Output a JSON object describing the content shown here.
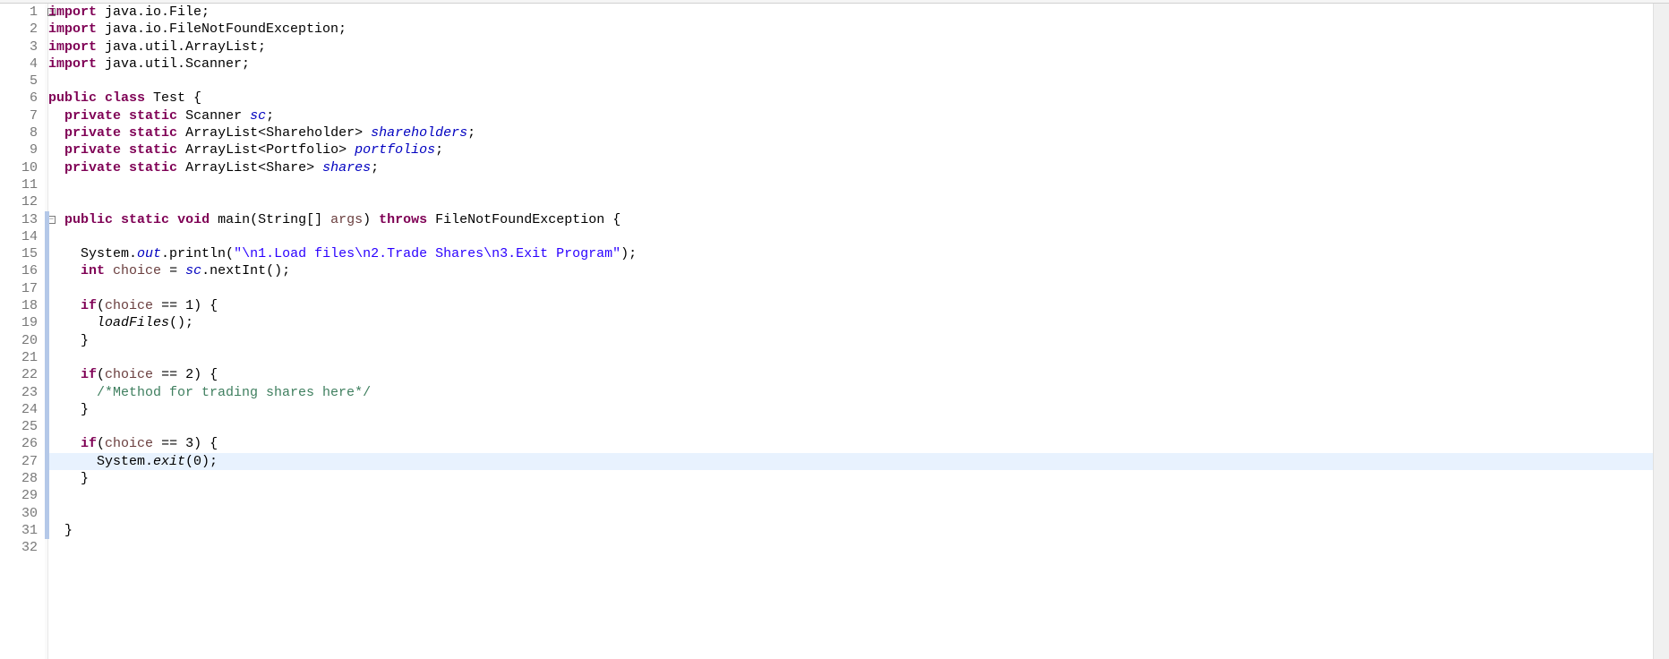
{
  "highlight_line": 27,
  "change_bar_start": 13,
  "change_bar_end": 31,
  "fold_markers": [
    1,
    13
  ],
  "lines": [
    {
      "n": 1,
      "tokens": [
        {
          "t": "import",
          "c": "kw"
        },
        {
          "t": " java.io.File;",
          "c": ""
        }
      ]
    },
    {
      "n": 2,
      "tokens": [
        {
          "t": "import",
          "c": "kw"
        },
        {
          "t": " java.io.FileNotFoundException;",
          "c": ""
        }
      ]
    },
    {
      "n": 3,
      "tokens": [
        {
          "t": "import",
          "c": "kw"
        },
        {
          "t": " java.util.ArrayList;",
          "c": ""
        }
      ]
    },
    {
      "n": 4,
      "tokens": [
        {
          "t": "import",
          "c": "kw"
        },
        {
          "t": " java.util.Scanner;",
          "c": ""
        }
      ]
    },
    {
      "n": 5,
      "tokens": []
    },
    {
      "n": 6,
      "tokens": [
        {
          "t": "public",
          "c": "kw"
        },
        {
          "t": " ",
          "c": ""
        },
        {
          "t": "class",
          "c": "kw"
        },
        {
          "t": " Test {",
          "c": ""
        }
      ]
    },
    {
      "n": 7,
      "tokens": [
        {
          "t": "  ",
          "c": ""
        },
        {
          "t": "private",
          "c": "kw"
        },
        {
          "t": " ",
          "c": ""
        },
        {
          "t": "static",
          "c": "kw"
        },
        {
          "t": " Scanner ",
          "c": ""
        },
        {
          "t": "sc",
          "c": "sfld"
        },
        {
          "t": ";",
          "c": ""
        }
      ]
    },
    {
      "n": 8,
      "tokens": [
        {
          "t": "  ",
          "c": ""
        },
        {
          "t": "private",
          "c": "kw"
        },
        {
          "t": " ",
          "c": ""
        },
        {
          "t": "static",
          "c": "kw"
        },
        {
          "t": " ArrayList<Shareholder> ",
          "c": ""
        },
        {
          "t": "shareholders",
          "c": "sfld"
        },
        {
          "t": ";",
          "c": ""
        }
      ]
    },
    {
      "n": 9,
      "tokens": [
        {
          "t": "  ",
          "c": ""
        },
        {
          "t": "private",
          "c": "kw"
        },
        {
          "t": " ",
          "c": ""
        },
        {
          "t": "static",
          "c": "kw"
        },
        {
          "t": " ArrayList<Portfolio> ",
          "c": ""
        },
        {
          "t": "portfolios",
          "c": "sfld"
        },
        {
          "t": ";",
          "c": ""
        }
      ]
    },
    {
      "n": 10,
      "tokens": [
        {
          "t": "  ",
          "c": ""
        },
        {
          "t": "private",
          "c": "kw"
        },
        {
          "t": " ",
          "c": ""
        },
        {
          "t": "static",
          "c": "kw"
        },
        {
          "t": " ArrayList<Share> ",
          "c": ""
        },
        {
          "t": "shares",
          "c": "sfld"
        },
        {
          "t": ";",
          "c": ""
        }
      ]
    },
    {
      "n": 11,
      "tokens": []
    },
    {
      "n": 12,
      "tokens": []
    },
    {
      "n": 13,
      "tokens": [
        {
          "t": "  ",
          "c": ""
        },
        {
          "t": "public",
          "c": "kw"
        },
        {
          "t": " ",
          "c": ""
        },
        {
          "t": "static",
          "c": "kw"
        },
        {
          "t": " ",
          "c": ""
        },
        {
          "t": "void",
          "c": "kw"
        },
        {
          "t": " main(String[] ",
          "c": ""
        },
        {
          "t": "args",
          "c": "arg"
        },
        {
          "t": ") ",
          "c": ""
        },
        {
          "t": "throws",
          "c": "kw"
        },
        {
          "t": " FileNotFoundException {",
          "c": ""
        }
      ]
    },
    {
      "n": 14,
      "tokens": []
    },
    {
      "n": 15,
      "tokens": [
        {
          "t": "    System.",
          "c": ""
        },
        {
          "t": "out",
          "c": "sfld"
        },
        {
          "t": ".println(",
          "c": ""
        },
        {
          "t": "\"\\n1.Load files\\n2.Trade Shares\\n3.Exit Program\"",
          "c": "str"
        },
        {
          "t": ");",
          "c": ""
        }
      ]
    },
    {
      "n": 16,
      "tokens": [
        {
          "t": "    ",
          "c": ""
        },
        {
          "t": "int",
          "c": "kw"
        },
        {
          "t": " ",
          "c": ""
        },
        {
          "t": "choice",
          "c": "loc"
        },
        {
          "t": " = ",
          "c": ""
        },
        {
          "t": "sc",
          "c": "sfld"
        },
        {
          "t": ".nextInt();",
          "c": ""
        }
      ]
    },
    {
      "n": 17,
      "tokens": []
    },
    {
      "n": 18,
      "tokens": [
        {
          "t": "    ",
          "c": ""
        },
        {
          "t": "if",
          "c": "kw"
        },
        {
          "t": "(",
          "c": ""
        },
        {
          "t": "choice",
          "c": "loc"
        },
        {
          "t": " == 1) {",
          "c": ""
        }
      ]
    },
    {
      "n": 19,
      "tokens": [
        {
          "t": "      ",
          "c": ""
        },
        {
          "t": "loadFiles",
          "c": "smeth"
        },
        {
          "t": "();",
          "c": ""
        }
      ]
    },
    {
      "n": 20,
      "tokens": [
        {
          "t": "    }",
          "c": ""
        }
      ]
    },
    {
      "n": 21,
      "tokens": []
    },
    {
      "n": 22,
      "tokens": [
        {
          "t": "    ",
          "c": ""
        },
        {
          "t": "if",
          "c": "kw"
        },
        {
          "t": "(",
          "c": ""
        },
        {
          "t": "choice",
          "c": "loc"
        },
        {
          "t": " == 2) {",
          "c": ""
        }
      ]
    },
    {
      "n": 23,
      "tokens": [
        {
          "t": "      ",
          "c": ""
        },
        {
          "t": "/*Method for trading shares here*/",
          "c": "com"
        }
      ]
    },
    {
      "n": 24,
      "tokens": [
        {
          "t": "    }",
          "c": ""
        }
      ]
    },
    {
      "n": 25,
      "tokens": []
    },
    {
      "n": 26,
      "tokens": [
        {
          "t": "    ",
          "c": ""
        },
        {
          "t": "if",
          "c": "kw"
        },
        {
          "t": "(",
          "c": ""
        },
        {
          "t": "choice",
          "c": "loc"
        },
        {
          "t": " == 3) {",
          "c": ""
        }
      ]
    },
    {
      "n": 27,
      "tokens": [
        {
          "t": "      System.",
          "c": ""
        },
        {
          "t": "exit",
          "c": "smeth"
        },
        {
          "t": "(0);",
          "c": ""
        }
      ]
    },
    {
      "n": 28,
      "tokens": [
        {
          "t": "    }",
          "c": ""
        }
      ]
    },
    {
      "n": 29,
      "tokens": []
    },
    {
      "n": 30,
      "tokens": []
    },
    {
      "n": 31,
      "tokens": [
        {
          "t": "  }",
          "c": ""
        }
      ]
    },
    {
      "n": 32,
      "tokens": []
    }
  ]
}
